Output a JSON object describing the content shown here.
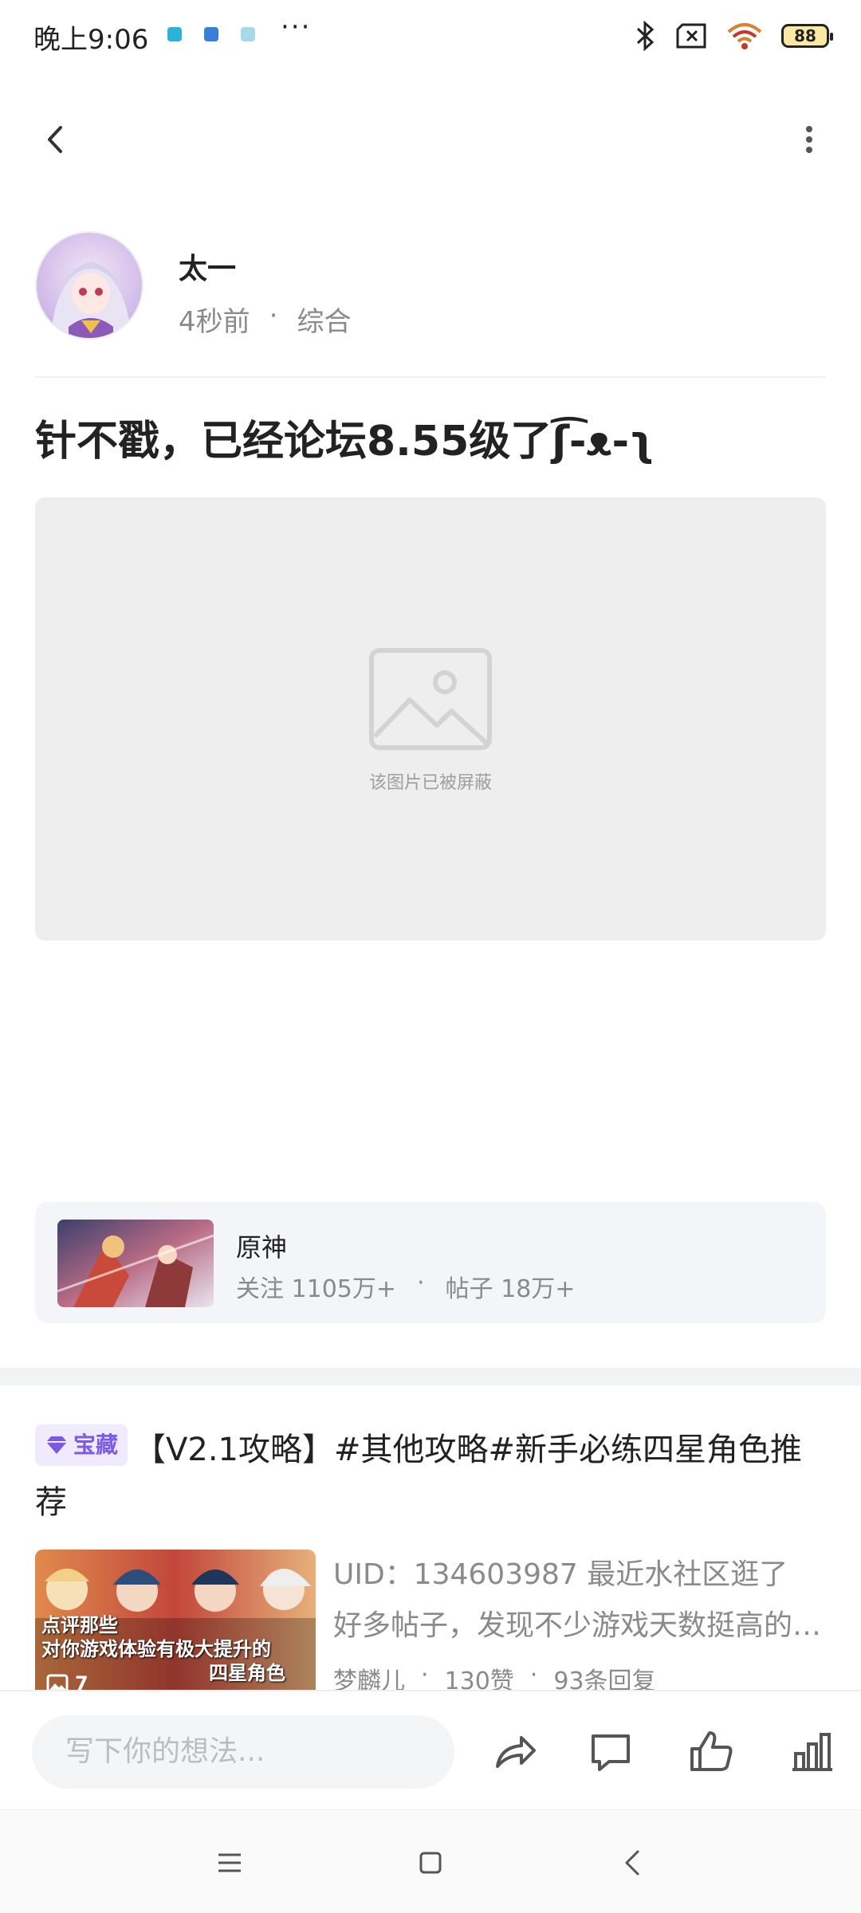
{
  "status_bar": {
    "time": "晚上9:06",
    "more": "···",
    "battery": "88"
  },
  "author": {
    "name": "太一",
    "time_ago": "4秒前",
    "separator": "·",
    "category": "综合"
  },
  "post": {
    "title": "针不戳，已经论坛8.55级了ʃ͡-ᴥ-ʅ",
    "blocked_image_text": "该图片已被屏蔽"
  },
  "game_card": {
    "name": "原神",
    "followers": "关注 1105万+",
    "separator": "·",
    "posts": "帖子 18万+"
  },
  "recommended": {
    "tag": "宝藏",
    "title": "【V2.1攻略】#其他攻略#新手必练四星角色推荐",
    "excerpt_line1": "UID：134603987 最近水社区逛了",
    "excerpt_line2": "好多帖子，发现不少游戏天数挺高的玩家",
    "author": "梦麟儿",
    "likes": "130赞",
    "replies": "93条回复",
    "meta_separator": "·",
    "thumb_caption_1": "点评那些",
    "thumb_caption_2": "对你游戏体验有极大提升的",
    "thumb_caption_3": "四星角色",
    "image_count": "7"
  },
  "action_bar": {
    "comment_placeholder": "写下你的想法..."
  },
  "icons": {
    "back": "chevron-left-icon",
    "more": "more-vertical-icon",
    "share": "share-icon",
    "comment": "comment-icon",
    "like": "thumbs-up-icon",
    "stats": "bar-chart-icon"
  },
  "colors": {
    "tag_bg": "#efeafd",
    "tag_text": "#7b5be6",
    "card_bg": "#f4f5f8"
  }
}
